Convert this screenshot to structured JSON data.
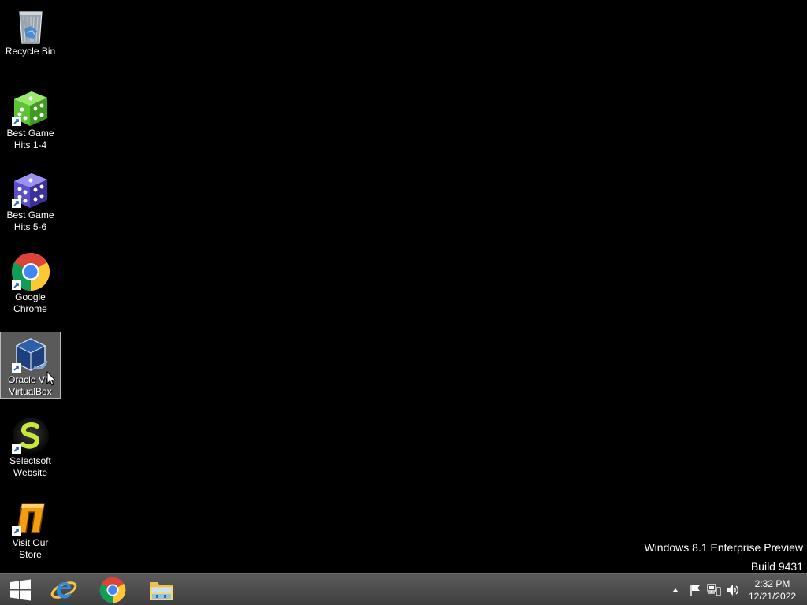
{
  "desktop": {
    "icons": [
      {
        "label": "Recycle Bin",
        "icon": "recycle-bin-icon"
      },
      {
        "label": "Best Game\nHits 1-4",
        "icon": "green-dice-icon"
      },
      {
        "label": "Best Game\nHits 5-6",
        "icon": "purple-dice-icon"
      },
      {
        "label": "Google\nChrome",
        "icon": "chrome-icon"
      },
      {
        "label": "Oracle VM\nVirtualBox",
        "icon": "virtualbox-icon"
      },
      {
        "label": "Selectsoft\nWebsite",
        "icon": "selectsoft-icon"
      },
      {
        "label": "Visit Our\nStore",
        "icon": "store-icon"
      }
    ],
    "selected_icon": "Oracle VM\nVirtualBox"
  },
  "watermark": {
    "line1": "Windows 8.1 Enterprise Preview",
    "line2": "Build 9431"
  },
  "taskbar": {
    "pinned": [
      "start-button",
      "internet-explorer",
      "google-chrome",
      "file-explorer"
    ],
    "tray_icons": [
      "show-hidden-icons",
      "action-center-flag",
      "network",
      "volume"
    ],
    "clock": {
      "time": "2:32 PM",
      "date": "12/21/2022"
    }
  },
  "colors": {
    "desktop_background": "#000000",
    "taskbar": "#4a4a4a",
    "selection": "#7a7a7a"
  }
}
